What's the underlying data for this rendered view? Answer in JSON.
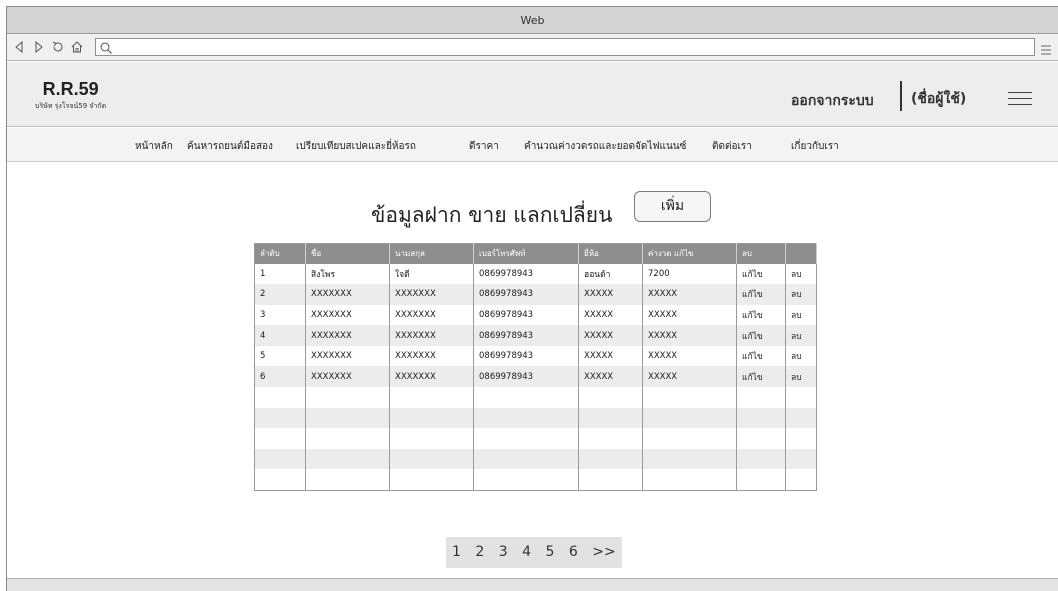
{
  "window": {
    "title": "Web"
  },
  "browser": {
    "url": ""
  },
  "site": {
    "logo_title": "R.R.59",
    "logo_subtitle": "บริษัท รุ่งโรจน์59 จำกัด",
    "logout": "ออกจากระบบ",
    "username": "(ชื่อผู้ใช้)"
  },
  "nav": [
    "หน้าหลัก",
    "ค้นหารถยนต์มือสอง",
    "เปรียบเทียบสเปคและยี่ห้อรถ",
    "ดีราคา",
    "คำนวณค่างวดรถและยอดจัดไฟแนนซ์",
    "ติดต่อเรา",
    "เกี่ยวกับเรา"
  ],
  "main": {
    "title": "ข้อมูลฝาก ขาย แลกเปลี่ยน",
    "add_label": "เพิ่ม"
  },
  "table": {
    "headers": [
      "ลำดับ",
      "ชื่อ",
      "นามสกุล",
      "เบอร์โทรศัพท์",
      "ยี่ห้อ",
      "ค่างวด แก้ไข",
      "ลบ",
      ""
    ],
    "rows": [
      [
        "1",
        "สิงโพร",
        "ใจดี",
        "0869978943",
        "ฮอนด้า",
        "7200",
        "แก้ไข",
        "ลบ"
      ],
      [
        "2",
        "XXXXXXX",
        "XXXXXXX",
        "0869978943",
        "XXXXX",
        "XXXXX",
        "แก้ไข",
        "ลบ"
      ],
      [
        "3",
        "XXXXXXX",
        "XXXXXXX",
        "0869978943",
        "XXXXX",
        "XXXXX",
        "แก้ไข",
        "ลบ"
      ],
      [
        "4",
        "XXXXXXX",
        "XXXXXXX",
        "0869978943",
        "XXXXX",
        "XXXXX",
        "แก้ไข",
        "ลบ"
      ],
      [
        "5",
        "XXXXXXX",
        "XXXXXXX",
        "0869978943",
        "XXXXX",
        "XXXXX",
        "แก้ไข",
        "ลบ"
      ],
      [
        "6",
        "XXXXXXX",
        "XXXXXXX",
        "0869978943",
        "XXXXX",
        "XXXXX",
        "แก้ไข",
        "ลบ"
      ]
    ],
    "empty_rows": 5
  },
  "pagination": [
    "1",
    "2",
    "3",
    "4",
    "5",
    "6",
    ">>"
  ],
  "icons": {
    "back": "back-arrow-icon",
    "forward": "forward-arrow-icon",
    "reload": "reload-icon",
    "home": "home-icon",
    "search": "search-icon",
    "menu": "menu-icon",
    "hamburger": "hamburger-icon"
  }
}
